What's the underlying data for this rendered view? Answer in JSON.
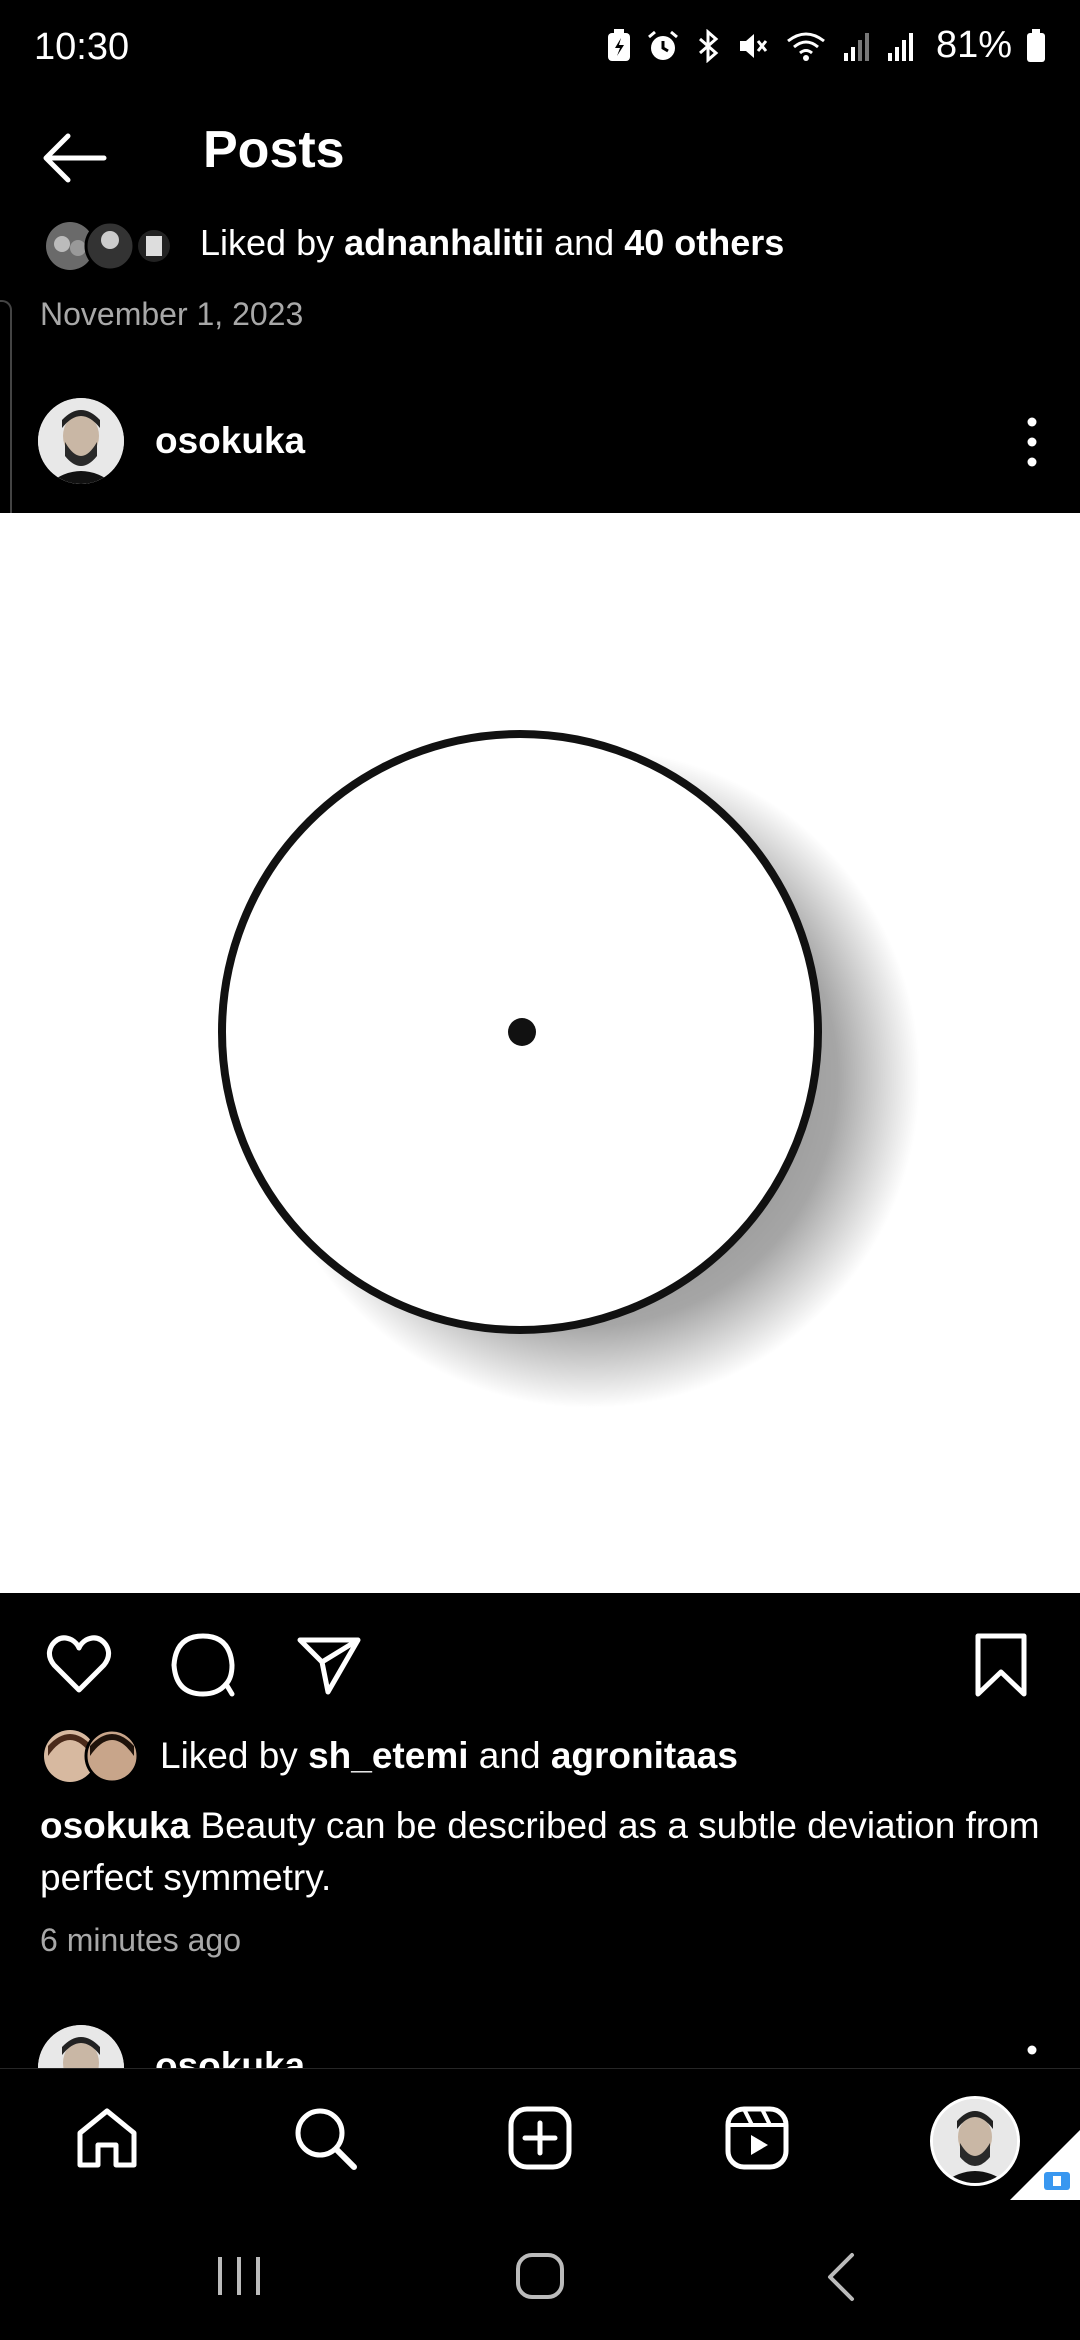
{
  "status_bar": {
    "time": "10:30",
    "battery": "81%",
    "icons": [
      "battery-saver-icon",
      "alarm-icon",
      "bluetooth-icon",
      "mute-icon",
      "wifi-icon",
      "signal-icon",
      "signal-icon",
      "battery-icon"
    ]
  },
  "header": {
    "title": "Posts",
    "back_icon": "arrow-left-icon"
  },
  "prev_post": {
    "liked_prefix": "Liked by ",
    "liked_user": "adnanhalitii",
    "liked_mid": " and ",
    "liked_others": "40 others",
    "date": "November 1, 2023"
  },
  "post": {
    "username": "osokuka",
    "liked_prefix": "Liked by ",
    "liked_user": "sh_etemi",
    "liked_mid": " and ",
    "liked_user2": "agronitaas",
    "caption_user": "osokuka",
    "caption_text": " Beauty can be described as a subtle deviation from perfect symmetry.",
    "time_ago": "6 minutes ago"
  },
  "next_post": {
    "username": "osokuka"
  },
  "bottom_nav": {
    "items": [
      "home-icon",
      "search-icon",
      "create-icon",
      "reels-icon",
      "profile-avatar"
    ]
  },
  "system_nav": [
    "recents-icon",
    "home-button-icon",
    "back-icon"
  ],
  "colors": {
    "background": "#000000",
    "text": "#ffffff",
    "muted": "#a8a8a8",
    "badge": "#3897f0"
  }
}
